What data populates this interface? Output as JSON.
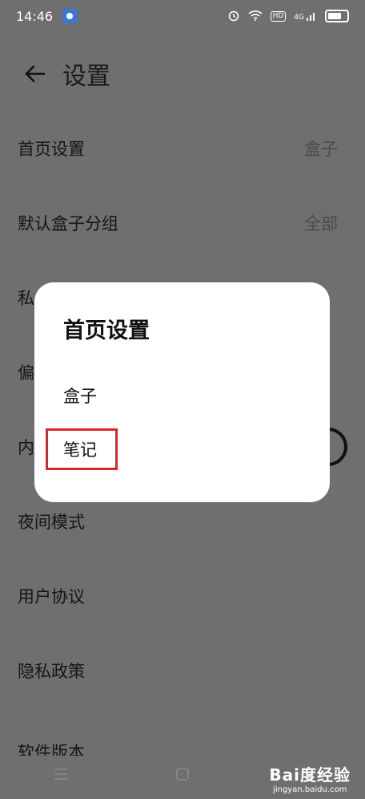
{
  "status_bar": {
    "time": "14:46",
    "hd_badge": "HD",
    "network": "4G"
  },
  "header": {
    "title": "设置"
  },
  "settings": {
    "items": [
      {
        "label": "首页设置",
        "value": "盒子"
      },
      {
        "label": "默认盒子分组",
        "value": "全部"
      },
      {
        "label": "私",
        "value": ""
      },
      {
        "label": "偏",
        "value": ""
      },
      {
        "label": "内",
        "value": ""
      },
      {
        "label": "夜间模式",
        "value": ""
      },
      {
        "label": "用户协议",
        "value": ""
      },
      {
        "label": "隐私政策",
        "value": ""
      },
      {
        "label": "软件版本",
        "value": ""
      }
    ]
  },
  "dialog": {
    "title": "首页设置",
    "options": [
      "盒子",
      "笔记"
    ]
  },
  "watermark": {
    "main": "Bai度经验",
    "sub": "jingyan.baidu.com"
  },
  "colors": {
    "overlay_bg": "#6f6f6f",
    "dialog_bg": "#ffffff",
    "highlight": "#d9262e"
  }
}
